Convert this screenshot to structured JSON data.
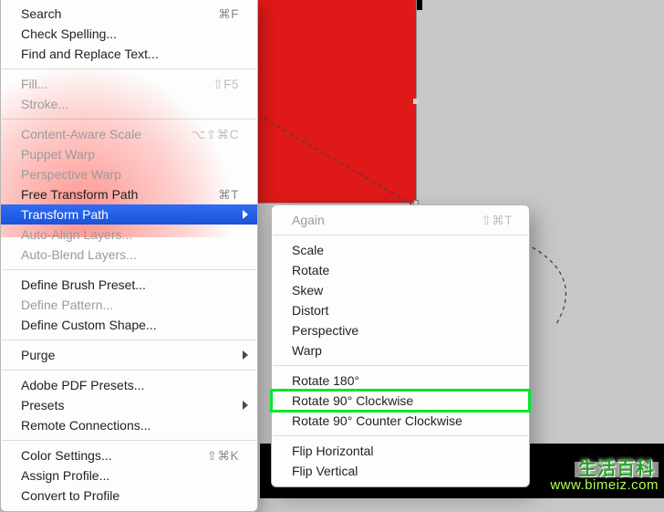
{
  "mainMenu": {
    "groups": [
      [
        {
          "label": "Search",
          "shortcut": "⌘F",
          "state": "enabled"
        },
        {
          "label": "Check Spelling...",
          "state": "enabled"
        },
        {
          "label": "Find and Replace Text...",
          "state": "enabled"
        }
      ],
      [
        {
          "label": "Fill...",
          "shortcut": "⇧F5",
          "state": "disabled"
        },
        {
          "label": "Stroke...",
          "state": "disabled"
        }
      ],
      [
        {
          "label": "Content-Aware Scale",
          "shortcut": "⌥⇧⌘C",
          "state": "disabled"
        },
        {
          "label": "Puppet Warp",
          "state": "disabled"
        },
        {
          "label": "Perspective Warp",
          "state": "disabled"
        },
        {
          "label": "Free Transform Path",
          "shortcut": "⌘T",
          "state": "enabled"
        },
        {
          "label": "Transform Path",
          "state": "selected",
          "submenu": true
        },
        {
          "label": "Auto-Align Layers...",
          "state": "disabled"
        },
        {
          "label": "Auto-Blend Layers...",
          "state": "disabled"
        }
      ],
      [
        {
          "label": "Define Brush Preset...",
          "state": "enabled"
        },
        {
          "label": "Define Pattern...",
          "state": "disabled"
        },
        {
          "label": "Define Custom Shape...",
          "state": "enabled"
        }
      ],
      [
        {
          "label": "Purge",
          "state": "enabled",
          "submenu": true
        }
      ],
      [
        {
          "label": "Adobe PDF Presets...",
          "state": "enabled"
        },
        {
          "label": "Presets",
          "state": "enabled",
          "submenu": true
        },
        {
          "label": "Remote Connections...",
          "state": "enabled"
        }
      ],
      [
        {
          "label": "Color Settings...",
          "shortcut": "⇧⌘K",
          "state": "enabled"
        },
        {
          "label": "Assign Profile...",
          "state": "enabled"
        },
        {
          "label": "Convert to Profile",
          "state": "enabled"
        }
      ]
    ]
  },
  "subMenu": {
    "groups": [
      [
        {
          "label": "Again",
          "shortcut": "⇧⌘T",
          "state": "disabled"
        }
      ],
      [
        {
          "label": "Scale",
          "state": "enabled"
        },
        {
          "label": "Rotate",
          "state": "enabled"
        },
        {
          "label": "Skew",
          "state": "enabled"
        },
        {
          "label": "Distort",
          "state": "enabled"
        },
        {
          "label": "Perspective",
          "state": "enabled"
        },
        {
          "label": "Warp",
          "state": "enabled"
        }
      ],
      [
        {
          "label": "Rotate 180°",
          "state": "enabled"
        },
        {
          "label": "Rotate 90° Clockwise",
          "state": "enabled",
          "highlight": true
        },
        {
          "label": "Rotate 90° Counter Clockwise",
          "state": "enabled"
        }
      ],
      [
        {
          "label": "Flip Horizontal",
          "state": "enabled"
        },
        {
          "label": "Flip Vertical",
          "state": "enabled"
        }
      ]
    ]
  },
  "watermark": {
    "cn": "生活百科",
    "url": "www.bimeiz.com"
  }
}
